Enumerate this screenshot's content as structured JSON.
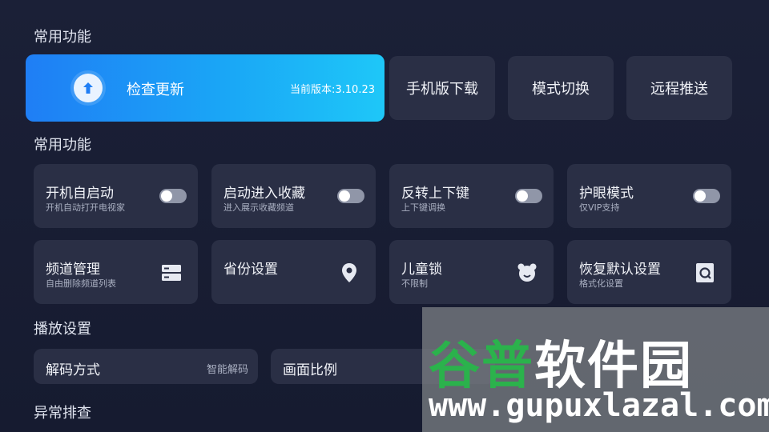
{
  "sections": {
    "common1": "常用功能",
    "common2": "常用功能",
    "playback": "播放设置",
    "troubleshoot": "异常排查"
  },
  "update": {
    "label": "检查更新",
    "version": "当前版本:3.10.23",
    "icon": "arrow-up-icon"
  },
  "top_buttons": [
    {
      "label": "手机版下载"
    },
    {
      "label": "模式切换"
    },
    {
      "label": "远程推送"
    }
  ],
  "toggles": [
    {
      "title": "开机自启动",
      "sub": "开机自动打开电视家",
      "on": false
    },
    {
      "title": "启动进入收藏",
      "sub": "进入展示收藏频道",
      "on": false
    },
    {
      "title": "反转上下键",
      "sub": "上下键调换",
      "on": false
    },
    {
      "title": "护眼模式",
      "sub": "仅VIP支持",
      "on": false
    }
  ],
  "settings": [
    {
      "title": "频道管理",
      "sub": "自由删除频道列表",
      "icon": "list-icon"
    },
    {
      "title": "省份设置",
      "sub": "",
      "icon": "location-pin-icon"
    },
    {
      "title": "儿童锁",
      "sub": "不限制",
      "icon": "bear-icon"
    },
    {
      "title": "恢复默认设置",
      "sub": "格式化设置",
      "icon": "reset-icon"
    }
  ],
  "playback": [
    {
      "title": "解码方式",
      "value": "智能解码"
    },
    {
      "title": "画面比例",
      "value": ""
    }
  ],
  "watermark": {
    "cn_green": "谷普",
    "cn_white": "软件园",
    "url": "www.gupuxlazal.com"
  },
  "colors": {
    "background": "#1b2037",
    "card": "#2a2f45",
    "accent_start": "#1f7ef5",
    "accent_end": "#1ec7f8"
  }
}
